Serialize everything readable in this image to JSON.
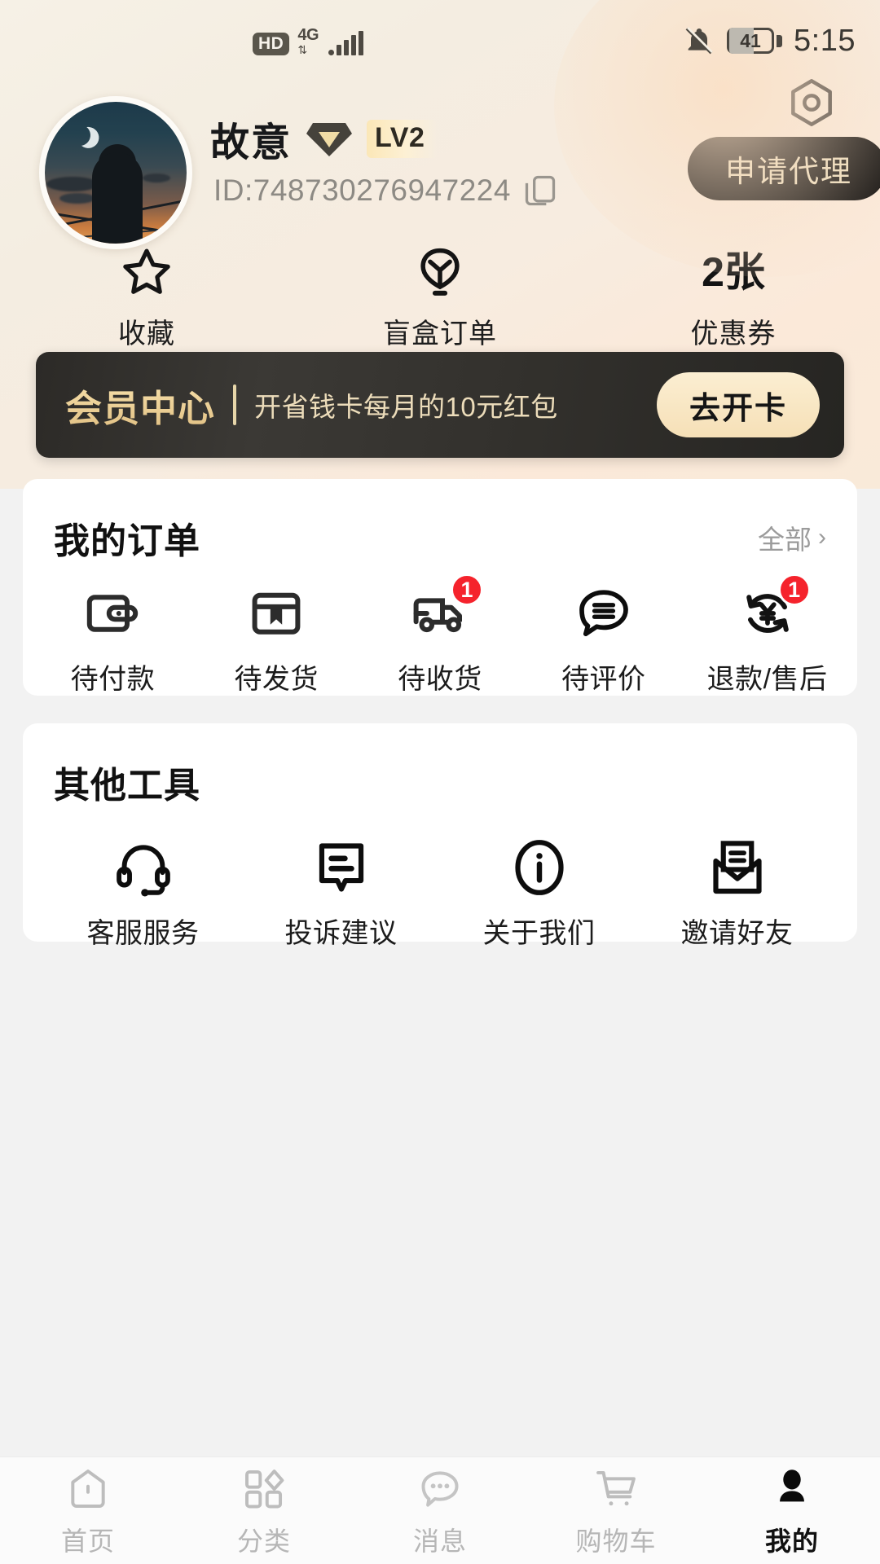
{
  "status_bar": {
    "hd_label": "HD",
    "network_type": "4G",
    "network_arrows": "⇅",
    "signal_icon": "signal-bars-icon",
    "mute_icon": "bell-off-icon",
    "battery_level": "41",
    "time": "5:15"
  },
  "profile": {
    "avatar_icon": "user-avatar",
    "username": "故意",
    "verified_icon": "v-diamond-badge-icon",
    "level_label": "LV2",
    "id_label": "ID:748730276947224",
    "copy_icon": "copy-icon",
    "settings_icon": "hexagon-gear-icon",
    "agent_button_label": "申请代理"
  },
  "stats": [
    {
      "icon": "star-icon",
      "value": "",
      "label": "收藏"
    },
    {
      "icon": "blindbox-icon",
      "value": "",
      "label": "盲盒订单"
    },
    {
      "icon": "",
      "value": "2张",
      "label": "优惠券"
    }
  ],
  "member_banner": {
    "title": "会员中心",
    "subtitle": "开省钱卡每月的10元红包",
    "button_label": "去开卡"
  },
  "orders": {
    "title": "我的订单",
    "all_label": "全部",
    "chevron": "›",
    "items": [
      {
        "icon": "wallet-icon",
        "label": "待付款",
        "badge": ""
      },
      {
        "icon": "package-icon",
        "label": "待发货",
        "badge": ""
      },
      {
        "icon": "truck-icon",
        "label": "待收货",
        "badge": "1"
      },
      {
        "icon": "comment-icon",
        "label": "待评价",
        "badge": ""
      },
      {
        "icon": "refund-icon",
        "label": "退款/售后",
        "badge": "1"
      }
    ]
  },
  "tools": {
    "title": "其他工具",
    "items": [
      {
        "icon": "headset-icon",
        "label": "客服服务"
      },
      {
        "icon": "feedback-icon",
        "label": "投诉建议"
      },
      {
        "icon": "info-icon",
        "label": "关于我们"
      },
      {
        "icon": "envelope-icon",
        "label": "邀请好友"
      }
    ]
  },
  "tabbar": {
    "items": [
      {
        "icon": "home-icon",
        "label": "首页",
        "active": false
      },
      {
        "icon": "category-icon",
        "label": "分类",
        "active": false
      },
      {
        "icon": "message-icon",
        "label": "消息",
        "active": false
      },
      {
        "icon": "cart-icon",
        "label": "购物车",
        "active": false
      },
      {
        "icon": "person-icon",
        "label": "我的",
        "active": true
      }
    ]
  },
  "colors": {
    "header_bg": "#f5efe3",
    "accent_gold": "#e9dcbd",
    "banner_dark": "#2f2d2a",
    "badge_red": "#f5232c",
    "page_bg": "#f2f2f2"
  }
}
